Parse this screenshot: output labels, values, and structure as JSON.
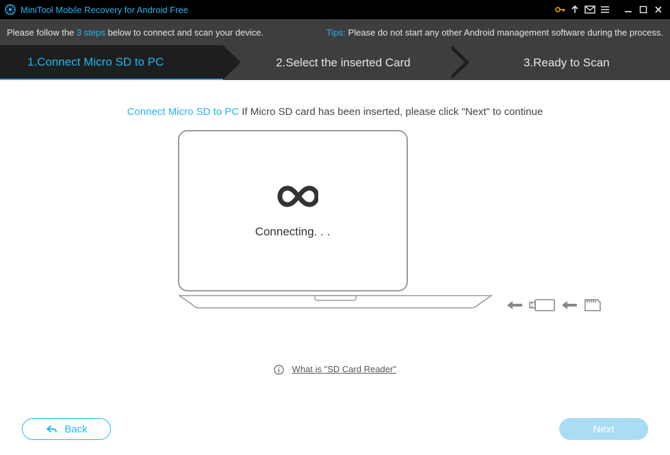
{
  "titlebar": {
    "app_title": "MiniTool Mobile Recovery for Android Free"
  },
  "infobar": {
    "left_pre": "Please follow the ",
    "left_hl": "3 steps",
    "left_post": " below to connect and scan your device.",
    "tips_label": "Tips:",
    "tips_text": "Please do not start any other Android management software during the process."
  },
  "steps": {
    "s1": "1.Connect Micro SD to PC",
    "s2": "2.Select the inserted Card",
    "s3": "3.Ready to Scan"
  },
  "instruction": {
    "hl": "Connect Micro SD to PC",
    "rest": " If Micro SD card has been inserted, please click \"Next\" to continue"
  },
  "status_text": "Connecting. . .",
  "help_link": "What is \"SD Card Reader\"",
  "buttons": {
    "back": "Back",
    "next": "Next"
  }
}
